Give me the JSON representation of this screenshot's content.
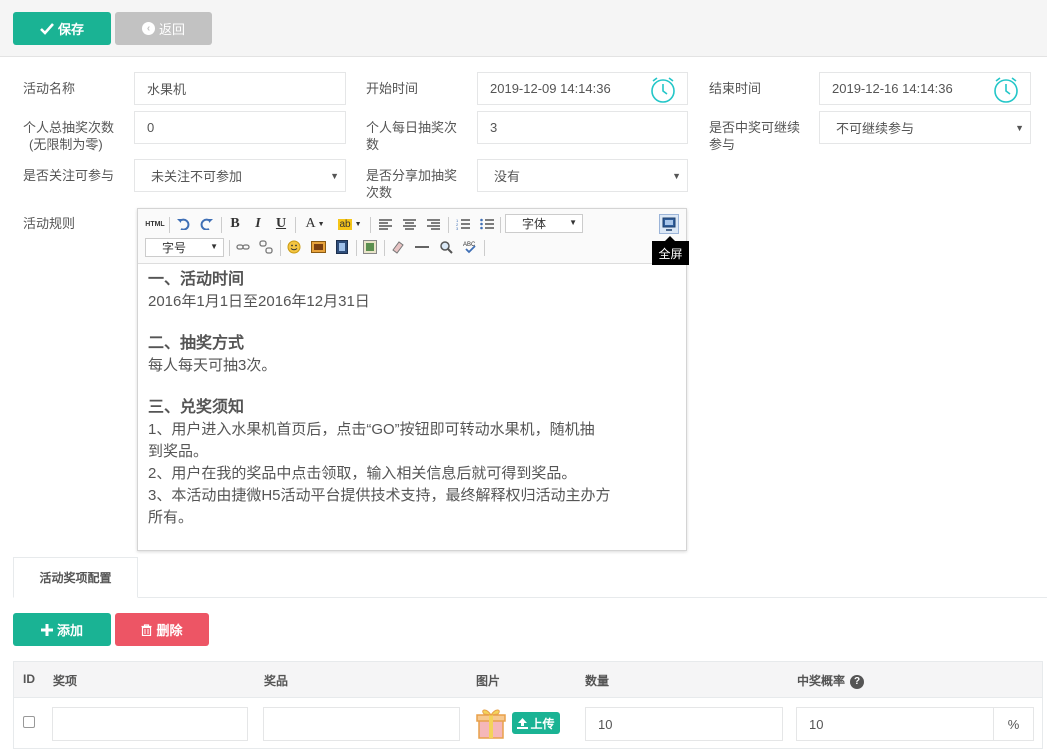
{
  "toolbar": {
    "save_label": "保存",
    "back_label": "返回"
  },
  "form": {
    "activity_name_label": "活动名称",
    "activity_name_value": "水果机",
    "start_time_label": "开始时间",
    "start_time_value": "2019-12-09 14:14:36",
    "end_time_label": "结束时间",
    "end_time_value": "2019-12-16 14:14:36",
    "total_draws_label_1": "个人总抽奖次数",
    "total_draws_label_2": "(无限制为零)",
    "total_draws_value": "0",
    "daily_draws_label_1": "个人每日抽奖次",
    "daily_draws_label_2": "数",
    "daily_draws_value": "3",
    "continue_after_win_label_1": "是否中奖可继续",
    "continue_after_win_label_2": "参与",
    "continue_after_win_value": "不可继续参与",
    "follow_required_label": "是否关注可参与",
    "follow_required_value": "未关注不可参加",
    "share_bonus_label_1": "是否分享加抽奖",
    "share_bonus_label_2": "次数",
    "share_bonus_value": "没有",
    "rules_label": "活动规则"
  },
  "editor": {
    "toolbar": {
      "html": "HTML",
      "font_family": "字体",
      "font_size": "字号",
      "fullscreen_tooltip": "全屏"
    },
    "content": {
      "h1": "一、活动时间",
      "p1": "2016年1月1日至2016年12月31日",
      "h2": "二、抽奖方式",
      "p2": "每人每天可抽3次。",
      "h3": "三、兑奖须知",
      "p3a": "1、用户进入水果机首页后，点击“GO”按钮即可转动水果机，随机抽",
      "p3b": "到奖品。",
      "p4": "2、用户在我的奖品中点击领取，输入相关信息后就可得到奖品。",
      "p5a": "3、本活动由捷微H5活动平台提供技术支持，最终解释权归活动主办方",
      "p5b": "所有。"
    }
  },
  "tabs": [
    {
      "label": "活动奖项配置"
    }
  ],
  "prize_actions": {
    "add_label": "添加",
    "delete_label": "删除"
  },
  "table": {
    "headers": {
      "id": "ID",
      "award": "奖项",
      "prize": "奖品",
      "image": "图片",
      "quantity": "数量",
      "probability": "中奖概率"
    },
    "rows": [
      {
        "award": "",
        "prize": "",
        "quantity": "10",
        "probability": "10",
        "unit": "%",
        "upload_label": "上传"
      }
    ]
  },
  "colors": {
    "primary": "#1ab394",
    "danger": "#ed5565",
    "disabled": "#c2c2c2",
    "clock": "#23c6c8"
  }
}
